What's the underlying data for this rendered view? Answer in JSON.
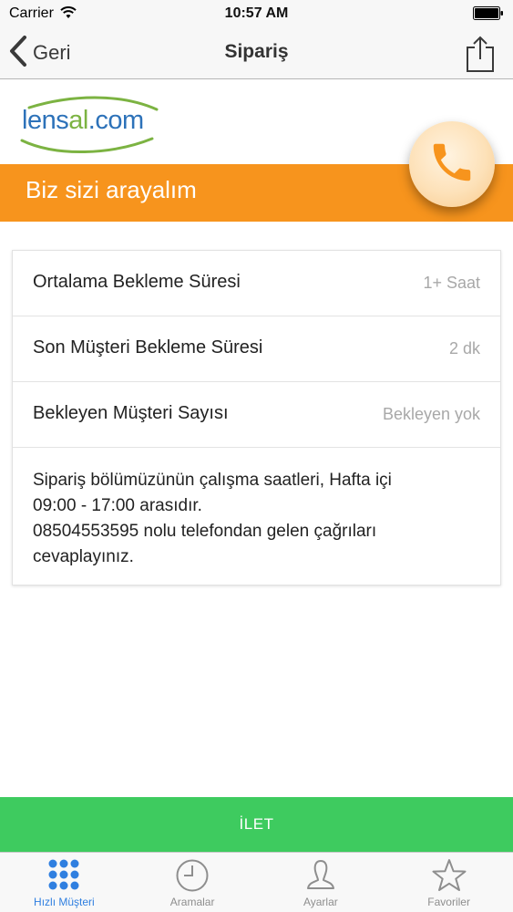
{
  "status_bar": {
    "carrier": "Carrier",
    "time": "10:57 AM"
  },
  "nav": {
    "back_label": "Geri",
    "title": "Sipariş"
  },
  "brand": {
    "logo_parts": [
      "lens",
      "al",
      ".com"
    ],
    "band_title": "Biz sizi arayalım"
  },
  "info": {
    "rows": [
      {
        "label": "Ortalama Bekleme Süresi",
        "value": "1+ Saat"
      },
      {
        "label": "Son Müşteri Bekleme Süresi",
        "value": "2 dk"
      },
      {
        "label": "Bekleyen Müşteri Sayısı",
        "value": "Bekleyen yok"
      }
    ],
    "notice_lines": [
      "Sipariş bölümüzünün çalışma saatleri, Hafta içi",
      "09:00 - 17:00 arasıdır.",
      "08504553595 nolu telefondan gelen çağrıları",
      "cevaplayınız."
    ]
  },
  "submit": {
    "label": "İLET"
  },
  "tabs": [
    {
      "label": "Hızlı Müşteri",
      "icon": "grid-icon",
      "active": true
    },
    {
      "label": "Aramalar",
      "icon": "clock-icon",
      "active": false
    },
    {
      "label": "Ayarlar",
      "icon": "person-icon",
      "active": false
    },
    {
      "label": "Favoriler",
      "icon": "star-icon",
      "active": false
    }
  ],
  "colors": {
    "accent_orange": "#f7941d",
    "submit_green": "#3ecb5f",
    "tab_active": "#2f7fe0",
    "logo_blue": "#2d72b9",
    "logo_green": "#7cb342"
  }
}
